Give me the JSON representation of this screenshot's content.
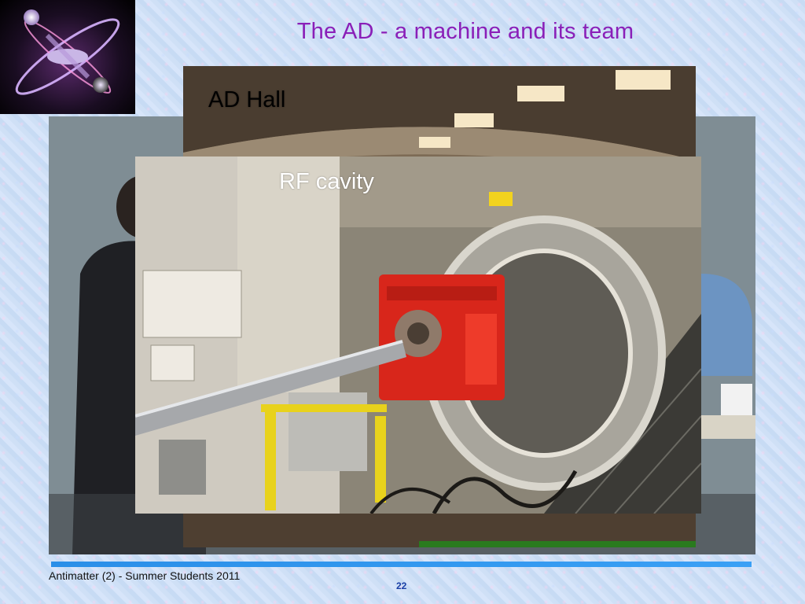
{
  "slide": {
    "title": "The AD - a machine and its team",
    "footer": "Antimatter (2) - Summer Students 2011",
    "page_number": "22"
  },
  "photos": {
    "hall_label": "AD Hall",
    "rf_label": "RF cavity"
  },
  "colors": {
    "title": "#8a1fb8",
    "footer_bar": "#2a8fe8",
    "page_number": "#1a3fa6",
    "rf_cavity_red": "#d8261b"
  }
}
